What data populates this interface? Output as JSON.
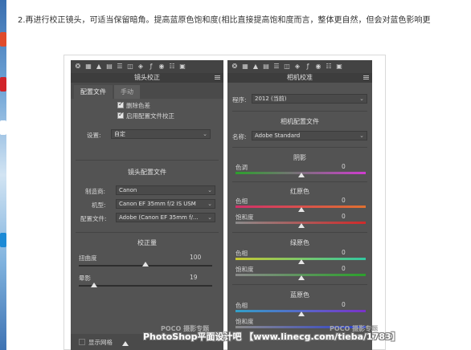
{
  "intro_text": "2.再进行校正镜头，可适当保留暗角。提高蓝原色饱和度(相比直接提高饱和度而言，整体更自然，但会对蓝色影响更",
  "toolbar_icons": [
    "aperture-icon",
    "grid-icon",
    "triangle-icon",
    "tone-curve-icon",
    "hsl-icon",
    "split-icon",
    "lens-icon",
    "fx-icon",
    "camera-icon",
    "preset-icon",
    "snapshot-icon"
  ],
  "left_panel": {
    "title": "镜头校正",
    "tabs": [
      "配置文件",
      "手动"
    ],
    "checkbox_remove_ca": "删除色差",
    "checkbox_enable_profile": "启用配置文件校正",
    "setup_label": "设置:",
    "setup_value": "自定",
    "profile_section_title": "镜头配置文件",
    "make_label": "制造商:",
    "make_value": "Canon",
    "model_label": "机型:",
    "model_value": "Canon EF 35mm f/2 IS USM",
    "profile_label": "配置文件:",
    "profile_value": "Adobe (Canon EF 35mm f/...",
    "amount_section_title": "校正量",
    "distortion_label": "扭曲度",
    "distortion_value": "100",
    "vignette_label": "晕影",
    "vignette_value": "19",
    "show_grid_label": "显示网格"
  },
  "right_panel": {
    "title": "相机校准",
    "process_label": "程序:",
    "process_value": "2012 (当前)",
    "camera_profile_title": "相机配置文件",
    "name_label": "名称:",
    "name_value": "Adobe Standard",
    "shadows_title": "阴影",
    "shadows_tint_label": "色调",
    "shadows_tint_value": "0",
    "red_title": "红原色",
    "red_hue_label": "色相",
    "red_hue_value": "0",
    "red_sat_label": "饱和度",
    "red_sat_value": "0",
    "green_title": "绿原色",
    "green_hue_label": "色相",
    "green_hue_value": "0",
    "green_sat_label": "饱和度",
    "green_sat_value": "0",
    "blue_title": "蓝原色",
    "blue_hue_label": "色相",
    "blue_hue_value": "0",
    "blue_sat_label": "饱和度"
  },
  "watermarks": {
    "poco_left": "POCO 摄影专题",
    "poco_right": "POCO 摄影专题",
    "footer": "PhotoShop平面设计吧 【www.linecg.com/tieba/1783】"
  }
}
